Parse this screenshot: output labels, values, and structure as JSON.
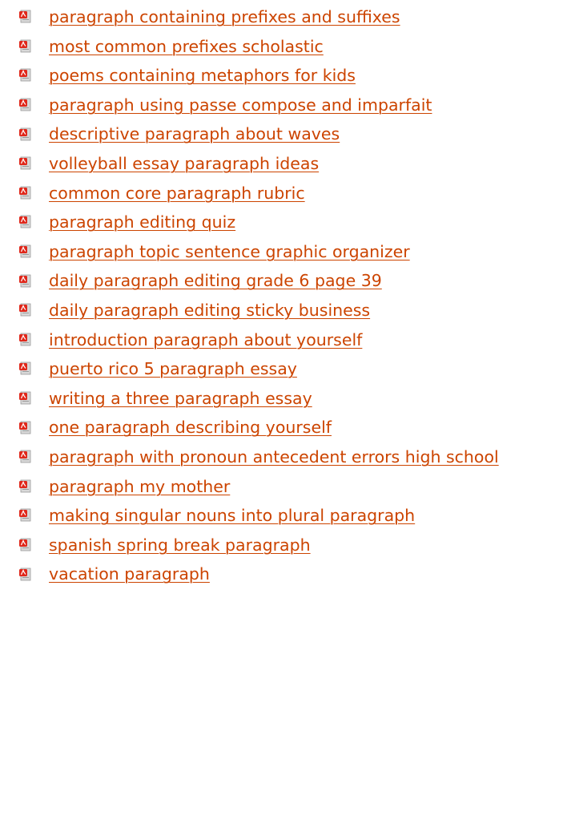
{
  "links": [
    {
      "label": "paragraph containing prefixes and suffixes",
      "icon": "pdf-file-icon"
    },
    {
      "label": "most common prefixes scholastic",
      "icon": "pdf-file-icon"
    },
    {
      "label": "poems containing metaphors for kids",
      "icon": "pdf-file-icon"
    },
    {
      "label": "paragraph using passe compose and imparfait",
      "icon": "pdf-file-icon"
    },
    {
      "label": "descriptive paragraph about waves",
      "icon": "pdf-file-icon"
    },
    {
      "label": "volleyball essay paragraph ideas",
      "icon": "pdf-file-icon"
    },
    {
      "label": "common core paragraph rubric",
      "icon": "pdf-file-icon"
    },
    {
      "label": "paragraph editing quiz",
      "icon": "pdf-file-icon"
    },
    {
      "label": "paragraph topic sentence graphic organizer",
      "icon": "pdf-file-icon"
    },
    {
      "label": "daily paragraph editing grade 6 page 39",
      "icon": "pdf-file-icon"
    },
    {
      "label": "daily paragraph editing sticky business",
      "icon": "pdf-file-icon"
    },
    {
      "label": "introduction paragraph about yourself",
      "icon": "pdf-file-icon"
    },
    {
      "label": "puerto rico 5 paragraph essay",
      "icon": "pdf-file-icon"
    },
    {
      "label": "writing a three paragraph essay",
      "icon": "pdf-file-icon"
    },
    {
      "label": "one paragraph describing yourself",
      "icon": "pdf-file-icon"
    },
    {
      "label": "paragraph with pronoun antecedent errors high school",
      "icon": "pdf-file-icon"
    },
    {
      "label": "paragraph my mother",
      "icon": "pdf-file-icon"
    },
    {
      "label": "making singular nouns into plural paragraph",
      "icon": "pdf-file-icon"
    },
    {
      "label": "spanish spring break paragraph",
      "icon": "pdf-file-icon"
    },
    {
      "label": "vacation paragraph",
      "icon": "pdf-file-icon"
    }
  ],
  "colors": {
    "link": "#cc4400",
    "pdf_red": "#e0271a",
    "page_grey": "#d8d8d8"
  }
}
